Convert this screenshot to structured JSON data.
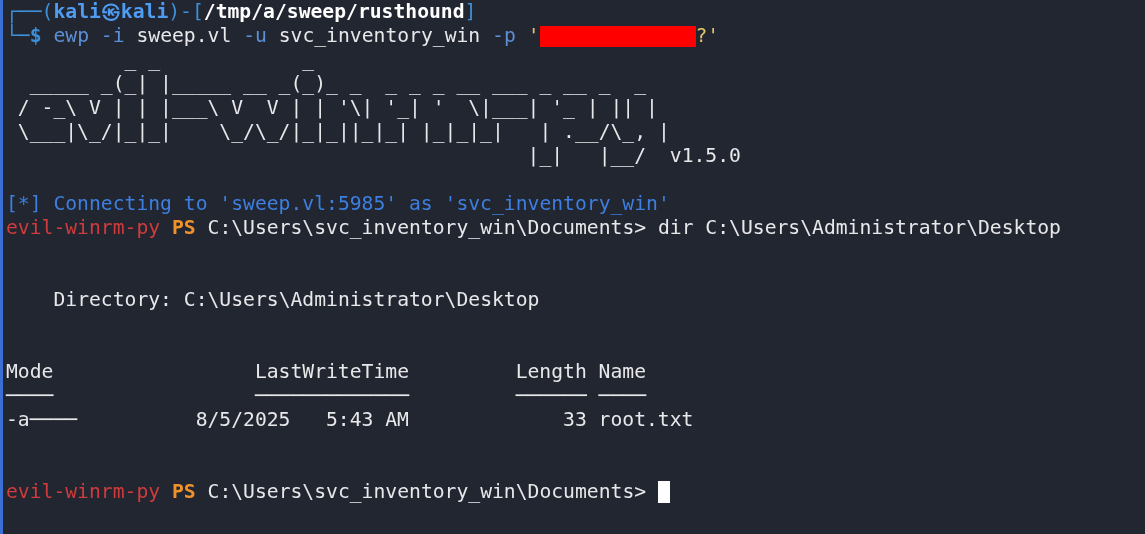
{
  "prompt": {
    "corner_top": "┌──(",
    "user": "kali",
    "at": "㉿",
    "host": "kali",
    "mid": ")-[",
    "path": "/tmp/a/sweep/rusthound",
    "close": "]",
    "corner_bottom": "└─",
    "symbol": "$"
  },
  "command": [
    {
      "kind": "cmd",
      "text": "ewp"
    },
    {
      "kind": "flag",
      "text": "-i"
    },
    {
      "kind": "arg",
      "text": "sweep.vl"
    },
    {
      "kind": "flag",
      "text": "-u"
    },
    {
      "kind": "arg",
      "text": "svc_inventory_win"
    },
    {
      "kind": "flag",
      "text": "-p"
    },
    {
      "kind": "quote",
      "text": "'"
    },
    {
      "kind": "redacted"
    },
    {
      "kind": "quote",
      "text": "?'"
    }
  ],
  "banner": {
    "art": [
      "          _ _            _",
      "  _____ _(_| |_____ __ _(_)_ _  _ _ _ __ ___ _ __ _  _",
      " / -_\\ V | | |___\\ V  V | | '\\| '_| '  \\|___| '_ | || |",
      " \\___|\\_/|_|_|    \\_/\\_/|_|_||_|_| |_|_|_|   | .__/\\_, |",
      "                                            |_|   |__/"
    ],
    "version": "v1.5.0"
  },
  "status": {
    "marker": "[*]",
    "text": "Connecting to 'sweep.vl:5985' as 'svc_inventory_win'"
  },
  "session_1": {
    "shell": "evil-winrm-py",
    "ps": "PS",
    "path": "C:\\Users\\svc_inventory_win\\Documents>",
    "command": "dir C:\\Users\\Administrator\\Desktop"
  },
  "listing": {
    "label": "Directory:",
    "path": "C:\\Users\\Administrator\\Desktop",
    "columns": [
      {
        "name": "Mode",
        "rule": "────",
        "kind": "text"
      },
      {
        "name": "LastWriteTime",
        "rule": "─────────────",
        "kind": "date"
      },
      {
        "name": "Length",
        "rule": "──────",
        "kind": "number"
      },
      {
        "name": "Name",
        "rule": "────",
        "kind": "text"
      }
    ],
    "rows": [
      [
        "-a────",
        "8/5/2025   5:43 AM",
        "33",
        "root.txt"
      ]
    ]
  },
  "session_2": {
    "shell": "evil-winrm-py",
    "ps": "PS",
    "path": "C:\\Users\\svc_inventory_win\\Documents>",
    "cursor": true
  }
}
